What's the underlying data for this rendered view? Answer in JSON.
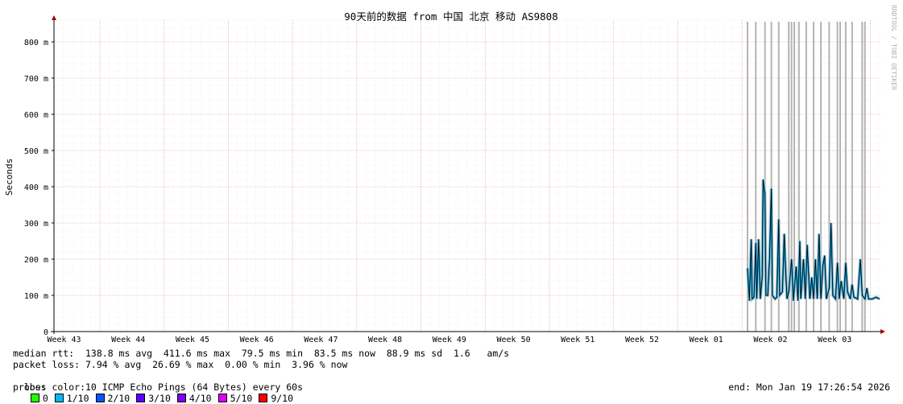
{
  "chart_data": {
    "type": "line",
    "title": "90天前的数据 from 中国 北京 移动 AS9808",
    "ylabel": "Seconds",
    "ylim": [
      0,
      860
    ],
    "yticks": [
      {
        "value": 0,
        "label": "0"
      },
      {
        "value": 100,
        "label": "100 m"
      },
      {
        "value": 200,
        "label": "200 m"
      },
      {
        "value": 300,
        "label": "300 m"
      },
      {
        "value": 400,
        "label": "400 m"
      },
      {
        "value": 500,
        "label": "500 m"
      },
      {
        "value": 600,
        "label": "600 m"
      },
      {
        "value": 700,
        "label": "700 m"
      },
      {
        "value": 800,
        "label": "800 m"
      }
    ],
    "x_unit": "days before end",
    "xlim": [
      -90,
      0
    ],
    "xticks": [
      {
        "label": "Week 43",
        "day": -88.9
      },
      {
        "label": "Week 44",
        "day": -81.9
      },
      {
        "label": "Week 45",
        "day": -74.9
      },
      {
        "label": "Week 46",
        "day": -67.9
      },
      {
        "label": "Week 47",
        "day": -60.9
      },
      {
        "label": "Week 48",
        "day": -53.9
      },
      {
        "label": "Week 49",
        "day": -46.9
      },
      {
        "label": "Week 50",
        "day": -39.9
      },
      {
        "label": "Week 51",
        "day": -32.9
      },
      {
        "label": "Week 52",
        "day": -25.9
      },
      {
        "label": "Week 01",
        "day": -18.9
      },
      {
        "label": "Week 02",
        "day": -11.9
      },
      {
        "label": "Week 03",
        "day": -4.9
      }
    ],
    "series": [
      {
        "name": "median rtt",
        "points": [
          [
            -14.4,
            175
          ],
          [
            -14.3,
            130
          ],
          [
            -14.2,
            85
          ],
          [
            -14.0,
            255
          ],
          [
            -13.9,
            90
          ],
          [
            -13.7,
            95
          ],
          [
            -13.5,
            245
          ],
          [
            -13.4,
            90
          ],
          [
            -13.2,
            255
          ],
          [
            -13.0,
            90
          ],
          [
            -12.8,
            150
          ],
          [
            -12.7,
            420
          ],
          [
            -12.5,
            380
          ],
          [
            -12.4,
            100
          ],
          [
            -12.2,
            100
          ],
          [
            -12.0,
            200
          ],
          [
            -11.8,
            395
          ],
          [
            -11.7,
            100
          ],
          [
            -11.4,
            90
          ],
          [
            -11.2,
            95
          ],
          [
            -11.0,
            310
          ],
          [
            -10.9,
            100
          ],
          [
            -10.6,
            110
          ],
          [
            -10.4,
            270
          ],
          [
            -10.3,
            200
          ],
          [
            -10.1,
            90
          ],
          [
            -9.9,
            110
          ],
          [
            -9.6,
            200
          ],
          [
            -9.4,
            85
          ],
          [
            -9.1,
            180
          ],
          [
            -8.9,
            85
          ],
          [
            -8.7,
            250
          ],
          [
            -8.6,
            90
          ],
          [
            -8.3,
            200
          ],
          [
            -8.1,
            90
          ],
          [
            -7.9,
            240
          ],
          [
            -7.6,
            90
          ],
          [
            -7.4,
            150
          ],
          [
            -7.2,
            90
          ],
          [
            -7.0,
            200
          ],
          [
            -6.8,
            90
          ],
          [
            -6.6,
            270
          ],
          [
            -6.4,
            90
          ],
          [
            -6.2,
            180
          ],
          [
            -6.0,
            210
          ],
          [
            -5.8,
            90
          ],
          [
            -5.5,
            120
          ],
          [
            -5.3,
            300
          ],
          [
            -5.1,
            100
          ],
          [
            -4.8,
            90
          ],
          [
            -4.6,
            190
          ],
          [
            -4.4,
            90
          ],
          [
            -4.2,
            140
          ],
          [
            -3.9,
            90
          ],
          [
            -3.7,
            190
          ],
          [
            -3.5,
            110
          ],
          [
            -3.2,
            90
          ],
          [
            -3.0,
            130
          ],
          [
            -2.8,
            95
          ],
          [
            -2.4,
            90
          ],
          [
            -2.1,
            200
          ],
          [
            -1.9,
            100
          ],
          [
            -1.6,
            90
          ],
          [
            -1.4,
            120
          ],
          [
            -1.2,
            90
          ],
          [
            -0.8,
            90
          ],
          [
            -0.4,
            95
          ],
          [
            0.0,
            90
          ]
        ]
      }
    ],
    "loss_spikes_days": [
      -14.4,
      -13.5,
      -12.5,
      -11.8,
      -11.0,
      -9.9,
      -9.6,
      -9.3,
      -8.8,
      -8.0,
      -7.2,
      -6.4,
      -5.5,
      -4.6,
      -4.3,
      -3.7,
      -3.0,
      -1.9,
      -1.6
    ],
    "grid": true
  },
  "stats": {
    "rtt_line": "median rtt:  138.8 ms avg  411.6 ms max  79.5 ms min  83.5 ms now  88.9 ms sd  1.6   am/s",
    "loss_line": "packet loss: 7.94 % avg  26.69 % max  0.00 % min  3.96 % now",
    "loss_color_label": "loss color:",
    "loss_colors": [
      {
        "label": "0",
        "color": "#26ff00"
      },
      {
        "label": "1/10",
        "color": "#00b8ff"
      },
      {
        "label": "2/10",
        "color": "#0059ff"
      },
      {
        "label": "3/10",
        "color": "#5e00ff"
      },
      {
        "label": "4/10",
        "color": "#7e00ff"
      },
      {
        "label": "5/10",
        "color": "#dd00ff"
      },
      {
        "label": "9/10",
        "color": "#ff0000"
      }
    ],
    "probe_line": "probe:       10 ICMP Echo Pings (64 Bytes) every 60s",
    "end_line": "end: Mon Jan 19 17:26:54 2026"
  },
  "watermark": "RRDTOOL / TOBI OETIKER"
}
